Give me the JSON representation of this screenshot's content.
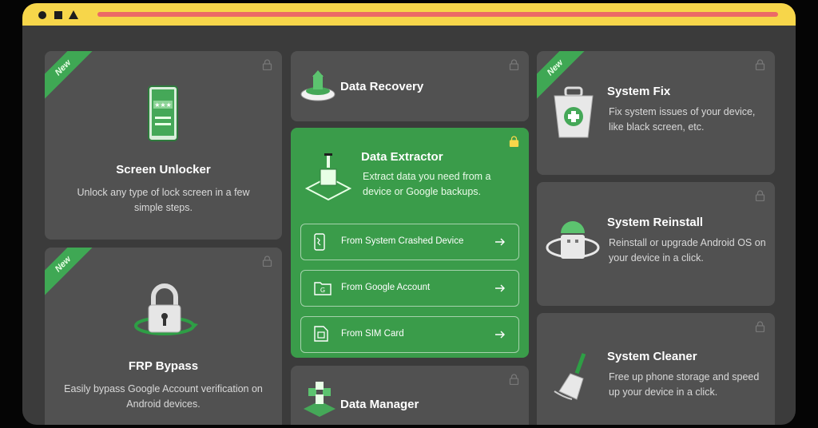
{
  "window": {
    "accent": "#f7d64a",
    "card_bg": "#515151",
    "highlight_bg": "#3a9c4a"
  },
  "badge_new": "New",
  "cards": {
    "screen_unlocker": {
      "title": "Screen Unlocker",
      "desc": "Unlock any type of lock screen in a few simple steps.",
      "badge": "New",
      "icon": "phone-unlock-icon"
    },
    "frp_bypass": {
      "title": "FRP Bypass",
      "desc": "Easily bypass Google Account verification on Android devices.",
      "badge": "New",
      "icon": "padlock-icon"
    },
    "data_recovery": {
      "title": "Data Recovery",
      "icon": "data-recovery-icon"
    },
    "data_extractor": {
      "title": "Data Extractor",
      "desc": "Extract data you need from a device or Google backups.",
      "icon": "data-extractor-icon",
      "options": [
        {
          "label": "From System Crashed Device",
          "icon": "crashed-phone-icon"
        },
        {
          "label": "From Google Account",
          "icon": "google-icon"
        },
        {
          "label": "From SIM Card",
          "icon": "sim-card-icon"
        }
      ]
    },
    "data_manager": {
      "title": "Data Manager",
      "icon": "data-manager-icon"
    },
    "system_fix": {
      "title": "System Fix",
      "desc": "Fix system issues of your device, like black screen, etc.",
      "badge": "New",
      "icon": "first-aid-kit-icon"
    },
    "system_reinstall": {
      "title": "System Reinstall",
      "desc": "Reinstall or upgrade Android OS on your device in a click.",
      "icon": "android-reinstall-icon"
    },
    "system_cleaner": {
      "title": "System Cleaner",
      "desc": "Free up phone storage and speed up your device in a click.",
      "icon": "broom-icon"
    }
  }
}
